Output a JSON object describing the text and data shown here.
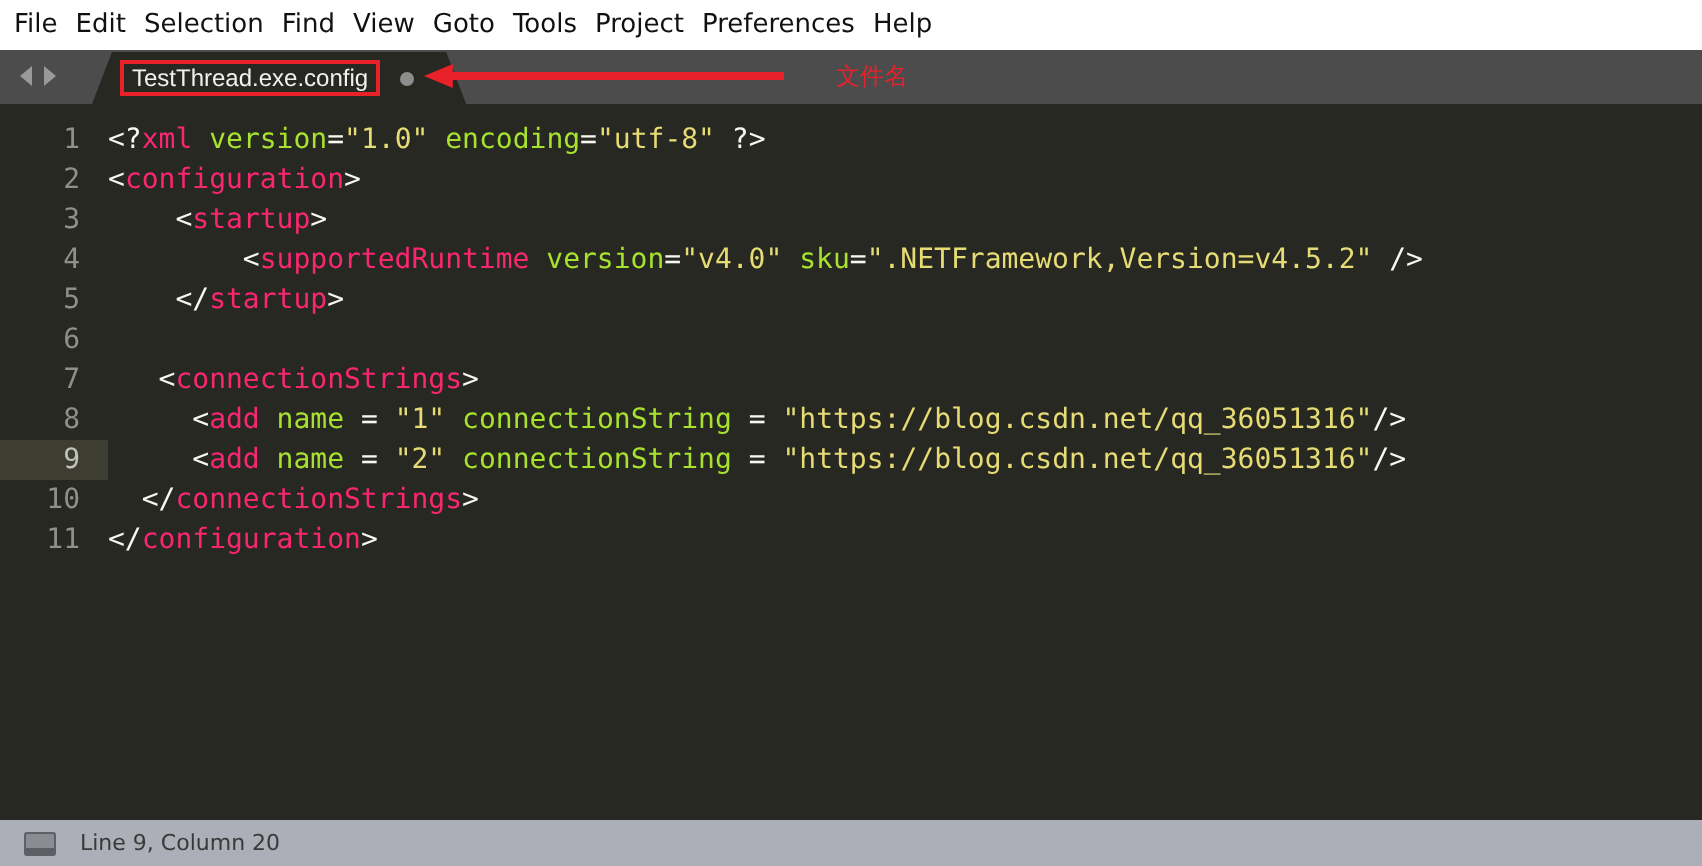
{
  "menu": [
    "File",
    "Edit",
    "Selection",
    "Find",
    "View",
    "Goto",
    "Tools",
    "Project",
    "Preferences",
    "Help"
  ],
  "tab": {
    "label": "TestThread.exe.config",
    "modified": true
  },
  "annotation": {
    "label": "文件名"
  },
  "lines": [
    {
      "number": "1",
      "current": false,
      "tokens": [
        {
          "kind": "punct",
          "text": "<?"
        },
        {
          "kind": "tag",
          "text": "xml"
        },
        {
          "kind": "attr",
          "text": " version"
        },
        {
          "kind": "punct",
          "text": "="
        },
        {
          "kind": "str",
          "text": "\"1.0\""
        },
        {
          "kind": "attr",
          "text": " encoding"
        },
        {
          "kind": "punct",
          "text": "="
        },
        {
          "kind": "str",
          "text": "\"utf-8\""
        },
        {
          "kind": "punct",
          "text": " ?>"
        }
      ]
    },
    {
      "number": "2",
      "current": false,
      "tokens": [
        {
          "kind": "punct",
          "text": "<"
        },
        {
          "kind": "tag",
          "text": "configuration"
        },
        {
          "kind": "punct",
          "text": ">"
        }
      ]
    },
    {
      "number": "3",
      "current": false,
      "tokens": [
        {
          "kind": "punct",
          "text": "    <"
        },
        {
          "kind": "tag",
          "text": "startup"
        },
        {
          "kind": "punct",
          "text": ">"
        }
      ]
    },
    {
      "number": "4",
      "current": false,
      "tokens": [
        {
          "kind": "punct",
          "text": "        <"
        },
        {
          "kind": "tag",
          "text": "supportedRuntime"
        },
        {
          "kind": "attr",
          "text": " version"
        },
        {
          "kind": "punct",
          "text": "="
        },
        {
          "kind": "str",
          "text": "\"v4.0\""
        },
        {
          "kind": "attr",
          "text": " sku"
        },
        {
          "kind": "punct",
          "text": "="
        },
        {
          "kind": "str",
          "text": "\".NETFramework,Version=v4.5.2\""
        },
        {
          "kind": "punct",
          "text": " />"
        }
      ]
    },
    {
      "number": "5",
      "current": false,
      "tokens": [
        {
          "kind": "punct",
          "text": "    </"
        },
        {
          "kind": "tag",
          "text": "startup"
        },
        {
          "kind": "punct",
          "text": ">"
        }
      ]
    },
    {
      "number": "6",
      "current": false
    },
    {
      "number": "7",
      "current": false,
      "tokens": [
        {
          "kind": "punct",
          "text": "   <"
        },
        {
          "kind": "tag",
          "text": "connectionStrings"
        },
        {
          "kind": "punct",
          "text": ">"
        }
      ]
    },
    {
      "number": "8",
      "current": false,
      "tokens": [
        {
          "kind": "punct",
          "text": "     <"
        },
        {
          "kind": "tag",
          "text": "add"
        },
        {
          "kind": "attr",
          "text": " name"
        },
        {
          "kind": "punct",
          "text": " = "
        },
        {
          "kind": "str",
          "text": "\"1\""
        },
        {
          "kind": "attr",
          "text": " connectionString"
        },
        {
          "kind": "punct",
          "text": " = "
        },
        {
          "kind": "str",
          "text": "\"https://blog.csdn.net/qq_36051316\""
        },
        {
          "kind": "punct",
          "text": "/>"
        }
      ]
    },
    {
      "number": "9",
      "current": true,
      "tokens": [
        {
          "kind": "punct",
          "text": "     <"
        },
        {
          "kind": "tag",
          "text": "add"
        },
        {
          "kind": "attr",
          "text": " name"
        },
        {
          "kind": "punct",
          "text": " = "
        },
        {
          "kind": "str",
          "text": "\"2\""
        },
        {
          "kind": "attr",
          "text": " connectionString"
        },
        {
          "kind": "punct",
          "text": " = "
        },
        {
          "kind": "str",
          "text": "\"https://blog.csdn.net/qq_36051316\""
        },
        {
          "kind": "punct",
          "text": "/>"
        }
      ]
    },
    {
      "number": "10",
      "current": false,
      "tokens": [
        {
          "kind": "punct",
          "text": "  </"
        },
        {
          "kind": "tag",
          "text": "connectionStrings"
        },
        {
          "kind": "punct",
          "text": ">"
        }
      ]
    },
    {
      "number": "11",
      "current": false,
      "tokens": [
        {
          "kind": "punct",
          "text": "</"
        },
        {
          "kind": "tag",
          "text": "configuration"
        },
        {
          "kind": "punct",
          "text": ">"
        }
      ]
    }
  ],
  "status_bar": {
    "text": "Line 9, Column 20"
  }
}
